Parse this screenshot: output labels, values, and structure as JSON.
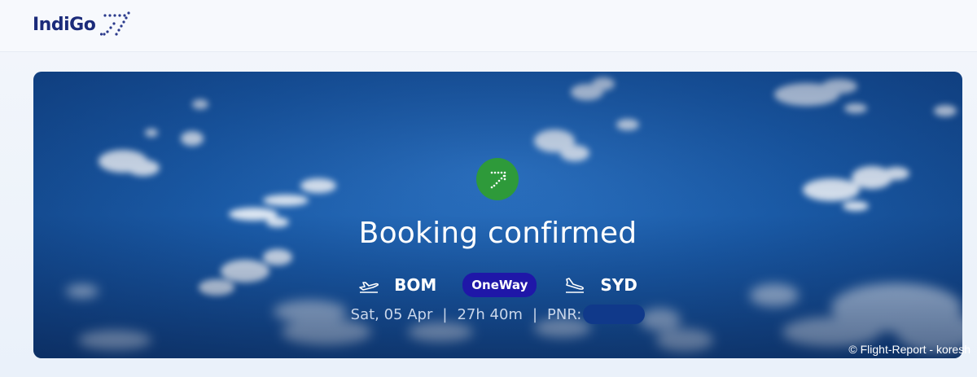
{
  "brand": {
    "name": "IndiGo",
    "logo_icon": "indigo-dotted-arrow-icon"
  },
  "hero": {
    "status_icon": "confirmed-arrow-icon",
    "title": "Booking confirmed",
    "origin": "BOM",
    "trip_type": "OneWay",
    "destination": "SYD",
    "date": "Sat, 05 Apr",
    "duration": "27h 40m",
    "pnr_label": "PNR:",
    "separator": "|"
  },
  "credit": "© Flight-Report - koresh",
  "colors": {
    "brand": "#1b2b7a",
    "success": "#2e9a3a",
    "trip_badge": "#1f17a8",
    "sky": "#1a5aa6"
  }
}
